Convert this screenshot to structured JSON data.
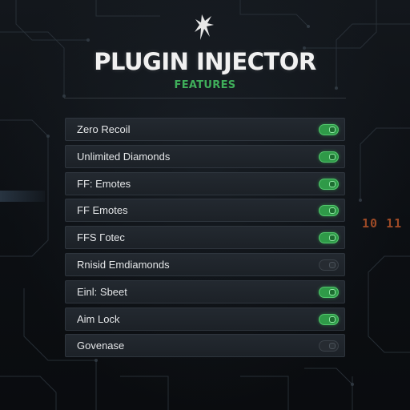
{
  "header": {
    "logo_icon": "bird-icon",
    "title": "PLUGIN INJECTOR",
    "subtitle": "FEATURES"
  },
  "colors": {
    "accent_green": "#3fae5a",
    "toggle_on": "#2f9a48",
    "toggle_off": "#262b31",
    "row_background": "#1f242a",
    "background": "#0d1014",
    "side_code": "#b8552a"
  },
  "features": [
    {
      "label": "Zero Recoil",
      "enabled": true
    },
    {
      "label": "Unlimited Diamonds",
      "enabled": true
    },
    {
      "label": "FF: Emotes",
      "enabled": true
    },
    {
      "label": "FF Emotes",
      "enabled": true
    },
    {
      "label": "FFS Γotec",
      "enabled": true
    },
    {
      "label": "Rnisid Emdiamonds",
      "enabled": false
    },
    {
      "label": "Einl: Sbeet",
      "enabled": true
    },
    {
      "label": "Aim Lock",
      "enabled": true
    },
    {
      "label": "Govenase",
      "enabled": false
    }
  ],
  "background_decor": {
    "side_code": "10 11"
  }
}
